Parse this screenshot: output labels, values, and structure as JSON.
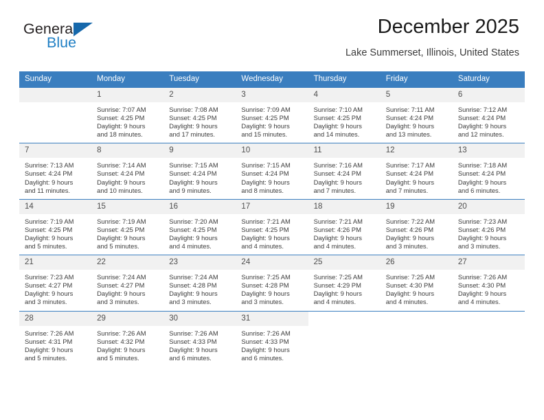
{
  "brand": {
    "word_one": "General",
    "word_two": "Blue",
    "triangle_color": "#1668ab",
    "blue_color": "#1f7fc4"
  },
  "header": {
    "title": "December 2025",
    "location": "Lake Summerset, Illinois, United States",
    "accent_color": "#3a7ebf",
    "daynum_bg": "#f1f1f1"
  },
  "weekday_headers": [
    "Sunday",
    "Monday",
    "Tuesday",
    "Wednesday",
    "Thursday",
    "Friday",
    "Saturday"
  ],
  "calendar_data": {
    "month": "December",
    "year": 2025,
    "weeks": [
      [
        {
          "day": ""
        },
        {
          "day": "1",
          "sunrise": "Sunrise: 7:07 AM",
          "sunset": "Sunset: 4:25 PM",
          "daylight_line1": "Daylight: 9 hours",
          "daylight_line2": "and 18 minutes."
        },
        {
          "day": "2",
          "sunrise": "Sunrise: 7:08 AM",
          "sunset": "Sunset: 4:25 PM",
          "daylight_line1": "Daylight: 9 hours",
          "daylight_line2": "and 17 minutes."
        },
        {
          "day": "3",
          "sunrise": "Sunrise: 7:09 AM",
          "sunset": "Sunset: 4:25 PM",
          "daylight_line1": "Daylight: 9 hours",
          "daylight_line2": "and 15 minutes."
        },
        {
          "day": "4",
          "sunrise": "Sunrise: 7:10 AM",
          "sunset": "Sunset: 4:25 PM",
          "daylight_line1": "Daylight: 9 hours",
          "daylight_line2": "and 14 minutes."
        },
        {
          "day": "5",
          "sunrise": "Sunrise: 7:11 AM",
          "sunset": "Sunset: 4:24 PM",
          "daylight_line1": "Daylight: 9 hours",
          "daylight_line2": "and 13 minutes."
        },
        {
          "day": "6",
          "sunrise": "Sunrise: 7:12 AM",
          "sunset": "Sunset: 4:24 PM",
          "daylight_line1": "Daylight: 9 hours",
          "daylight_line2": "and 12 minutes."
        }
      ],
      [
        {
          "day": "7",
          "sunrise": "Sunrise: 7:13 AM",
          "sunset": "Sunset: 4:24 PM",
          "daylight_line1": "Daylight: 9 hours",
          "daylight_line2": "and 11 minutes."
        },
        {
          "day": "8",
          "sunrise": "Sunrise: 7:14 AM",
          "sunset": "Sunset: 4:24 PM",
          "daylight_line1": "Daylight: 9 hours",
          "daylight_line2": "and 10 minutes."
        },
        {
          "day": "9",
          "sunrise": "Sunrise: 7:15 AM",
          "sunset": "Sunset: 4:24 PM",
          "daylight_line1": "Daylight: 9 hours",
          "daylight_line2": "and 9 minutes."
        },
        {
          "day": "10",
          "sunrise": "Sunrise: 7:15 AM",
          "sunset": "Sunset: 4:24 PM",
          "daylight_line1": "Daylight: 9 hours",
          "daylight_line2": "and 8 minutes."
        },
        {
          "day": "11",
          "sunrise": "Sunrise: 7:16 AM",
          "sunset": "Sunset: 4:24 PM",
          "daylight_line1": "Daylight: 9 hours",
          "daylight_line2": "and 7 minutes."
        },
        {
          "day": "12",
          "sunrise": "Sunrise: 7:17 AM",
          "sunset": "Sunset: 4:24 PM",
          "daylight_line1": "Daylight: 9 hours",
          "daylight_line2": "and 7 minutes."
        },
        {
          "day": "13",
          "sunrise": "Sunrise: 7:18 AM",
          "sunset": "Sunset: 4:24 PM",
          "daylight_line1": "Daylight: 9 hours",
          "daylight_line2": "and 6 minutes."
        }
      ],
      [
        {
          "day": "14",
          "sunrise": "Sunrise: 7:19 AM",
          "sunset": "Sunset: 4:25 PM",
          "daylight_line1": "Daylight: 9 hours",
          "daylight_line2": "and 5 minutes."
        },
        {
          "day": "15",
          "sunrise": "Sunrise: 7:19 AM",
          "sunset": "Sunset: 4:25 PM",
          "daylight_line1": "Daylight: 9 hours",
          "daylight_line2": "and 5 minutes."
        },
        {
          "day": "16",
          "sunrise": "Sunrise: 7:20 AM",
          "sunset": "Sunset: 4:25 PM",
          "daylight_line1": "Daylight: 9 hours",
          "daylight_line2": "and 4 minutes."
        },
        {
          "day": "17",
          "sunrise": "Sunrise: 7:21 AM",
          "sunset": "Sunset: 4:25 PM",
          "daylight_line1": "Daylight: 9 hours",
          "daylight_line2": "and 4 minutes."
        },
        {
          "day": "18",
          "sunrise": "Sunrise: 7:21 AM",
          "sunset": "Sunset: 4:26 PM",
          "daylight_line1": "Daylight: 9 hours",
          "daylight_line2": "and 4 minutes."
        },
        {
          "day": "19",
          "sunrise": "Sunrise: 7:22 AM",
          "sunset": "Sunset: 4:26 PM",
          "daylight_line1": "Daylight: 9 hours",
          "daylight_line2": "and 3 minutes."
        },
        {
          "day": "20",
          "sunrise": "Sunrise: 7:23 AM",
          "sunset": "Sunset: 4:26 PM",
          "daylight_line1": "Daylight: 9 hours",
          "daylight_line2": "and 3 minutes."
        }
      ],
      [
        {
          "day": "21",
          "sunrise": "Sunrise: 7:23 AM",
          "sunset": "Sunset: 4:27 PM",
          "daylight_line1": "Daylight: 9 hours",
          "daylight_line2": "and 3 minutes."
        },
        {
          "day": "22",
          "sunrise": "Sunrise: 7:24 AM",
          "sunset": "Sunset: 4:27 PM",
          "daylight_line1": "Daylight: 9 hours",
          "daylight_line2": "and 3 minutes."
        },
        {
          "day": "23",
          "sunrise": "Sunrise: 7:24 AM",
          "sunset": "Sunset: 4:28 PM",
          "daylight_line1": "Daylight: 9 hours",
          "daylight_line2": "and 3 minutes."
        },
        {
          "day": "24",
          "sunrise": "Sunrise: 7:25 AM",
          "sunset": "Sunset: 4:28 PM",
          "daylight_line1": "Daylight: 9 hours",
          "daylight_line2": "and 3 minutes."
        },
        {
          "day": "25",
          "sunrise": "Sunrise: 7:25 AM",
          "sunset": "Sunset: 4:29 PM",
          "daylight_line1": "Daylight: 9 hours",
          "daylight_line2": "and 4 minutes."
        },
        {
          "day": "26",
          "sunrise": "Sunrise: 7:25 AM",
          "sunset": "Sunset: 4:30 PM",
          "daylight_line1": "Daylight: 9 hours",
          "daylight_line2": "and 4 minutes."
        },
        {
          "day": "27",
          "sunrise": "Sunrise: 7:26 AM",
          "sunset": "Sunset: 4:30 PM",
          "daylight_line1": "Daylight: 9 hours",
          "daylight_line2": "and 4 minutes."
        }
      ],
      [
        {
          "day": "28",
          "sunrise": "Sunrise: 7:26 AM",
          "sunset": "Sunset: 4:31 PM",
          "daylight_line1": "Daylight: 9 hours",
          "daylight_line2": "and 5 minutes."
        },
        {
          "day": "29",
          "sunrise": "Sunrise: 7:26 AM",
          "sunset": "Sunset: 4:32 PM",
          "daylight_line1": "Daylight: 9 hours",
          "daylight_line2": "and 5 minutes."
        },
        {
          "day": "30",
          "sunrise": "Sunrise: 7:26 AM",
          "sunset": "Sunset: 4:33 PM",
          "daylight_line1": "Daylight: 9 hours",
          "daylight_line2": "and 6 minutes."
        },
        {
          "day": "31",
          "sunrise": "Sunrise: 7:26 AM",
          "sunset": "Sunset: 4:33 PM",
          "daylight_line1": "Daylight: 9 hours",
          "daylight_line2": "and 6 minutes."
        },
        {
          "day": ""
        },
        {
          "day": ""
        },
        {
          "day": ""
        }
      ]
    ]
  }
}
